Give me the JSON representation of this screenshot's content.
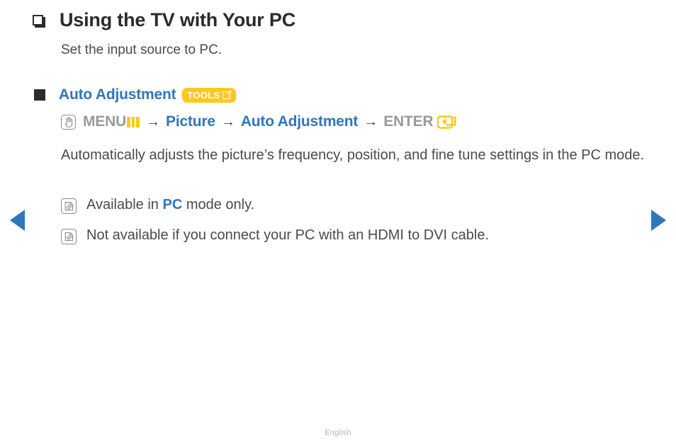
{
  "page": {
    "footer_label": "English"
  },
  "nav": {
    "prev_label": "Previous page",
    "next_label": "Next page"
  },
  "heading": {
    "bullet_icon": "hollow-square-bullet-icon",
    "title": "Using the TV with Your PC",
    "subtitle": "Set the input source to PC."
  },
  "section": {
    "bullet_icon": "solid-square-bullet-icon",
    "title": "Auto Adjustment",
    "badge": {
      "label": "TOOLS",
      "icon": "tools-shortcut-icon",
      "background_color": "#ffc81e",
      "text_color": "#ffffff"
    },
    "path": {
      "hand_icon": "hand-press-icon",
      "menu_label": "MENU",
      "menu_icon": "menu-bars-icon",
      "arrow": "→",
      "step_picture": "Picture",
      "step_auto_adjustment": "Auto Adjustment",
      "enter_label": "ENTER",
      "enter_icon": "enter-key-icon"
    },
    "paragraph": "Automatically adjusts the picture’s frequency, position, and fine tune settings in the PC mode.",
    "notes": [
      {
        "icon": "note-pencil-icon",
        "prefix": "Available in ",
        "highlight": "PC",
        "suffix": " mode only."
      },
      {
        "icon": "note-pencil-icon",
        "prefix": "Not available if you connect your PC with an HDMI to DVI cable.",
        "highlight": "",
        "suffix": ""
      }
    ]
  },
  "colors": {
    "accent_blue": "#2f76bb",
    "accent_yellow": "#ffc81e",
    "body_gray": "#4a4a4a",
    "muted_gray": "#9a9a9a"
  }
}
